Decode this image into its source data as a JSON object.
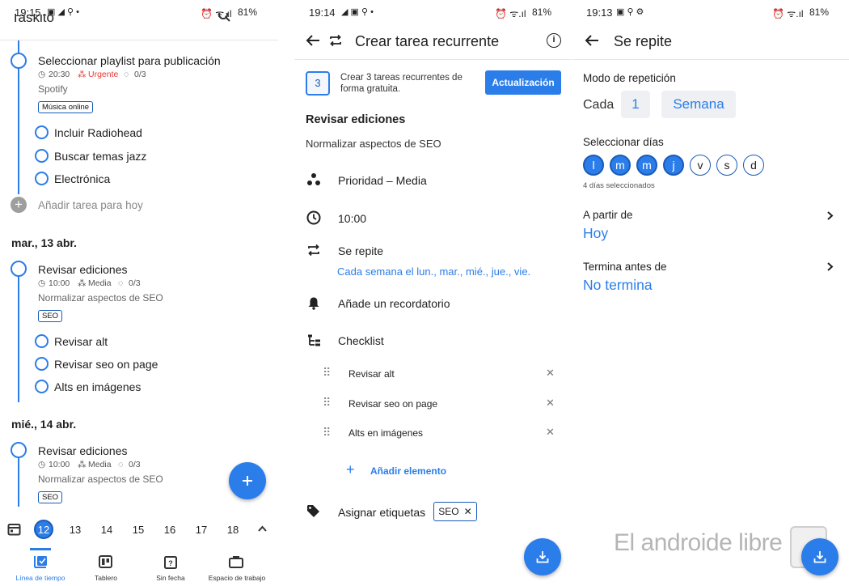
{
  "panel1": {
    "status_time": "19:15",
    "status_battery": "81%",
    "app_title": "Taskito",
    "tasks_today": [
      {
        "title": "Seleccionar playlist para publicación",
        "time": "20:30",
        "priority": "Urgente",
        "progress": "0/3",
        "note": "Spotify",
        "tag": "Música online",
        "subtasks": [
          "Incluir Radiohead",
          "Buscar temas jazz",
          "Electrónica"
        ]
      }
    ],
    "add_task_label": "Añadir tarea para hoy",
    "day2": {
      "header": "mar., 13 abr.",
      "title": "Revisar ediciones",
      "time": "10:00",
      "priority": "Media",
      "progress": "0/3",
      "note": "Normalizar aspectos de SEO",
      "tag": "SEO",
      "subtasks": [
        "Revisar alt",
        "Revisar seo on page",
        "Alts en imágenes"
      ]
    },
    "day3": {
      "header": "mié., 14 abr.",
      "title": "Revisar ediciones",
      "time": "10:00",
      "priority": "Media",
      "progress": "0/3",
      "note": "Normalizar aspectos de SEO",
      "tag": "SEO"
    },
    "calendar_days": [
      "12",
      "13",
      "14",
      "15",
      "16",
      "17",
      "18"
    ],
    "nav": [
      "Línea de tiempo",
      "Tablero",
      "Sin fecha",
      "Espacio de trabajo"
    ]
  },
  "panel2": {
    "status_time": "19:14",
    "status_battery": "81%",
    "header_title": "Crear tarea recurrente",
    "promo_number": "3",
    "promo_text_1": "Crear 3 tareas recurrentes de",
    "promo_text_2": "forma gratuita.",
    "promo_button": "Actualización",
    "task_title": "Revisar ediciones",
    "task_note": "Normalizar aspectos de SEO",
    "priority_label": "Prioridad – Media",
    "time_label": "10:00",
    "repeat_label": "Se repite",
    "repeat_value": "Cada semana el lun., mar., mié., jue., vie.",
    "reminder_label": "Añade un recordatorio",
    "checklist_label": "Checklist",
    "checklist_items": [
      "Revisar alt",
      "Revisar seo on page",
      "Alts en imágenes"
    ],
    "add_item_label": "Añadir elemento",
    "tags_label": "Asignar etiquetas",
    "tag_chip": "SEO"
  },
  "panel3": {
    "status_time": "19:13",
    "status_battery": "81%",
    "header_title": "Se repite",
    "mode_label": "Modo de repetición",
    "each_label": "Cada",
    "each_value": "1",
    "unit_value": "Semana",
    "select_days_label": "Seleccionar días",
    "days": [
      {
        "letter": "l",
        "selected": true
      },
      {
        "letter": "m",
        "selected": true
      },
      {
        "letter": "m",
        "selected": true
      },
      {
        "letter": "j",
        "selected": true
      },
      {
        "letter": "v",
        "selected": false
      },
      {
        "letter": "s",
        "selected": false
      },
      {
        "letter": "d",
        "selected": false
      }
    ],
    "days_count": "4 días seleccionados",
    "from_label": "A partir de",
    "from_value": "Hoy",
    "ends_label": "Termina antes de",
    "ends_value": "No termina",
    "watermark": "El androide libre"
  },
  "colors": {
    "accent": "#2b7de9",
    "urgent": "#e53935"
  }
}
